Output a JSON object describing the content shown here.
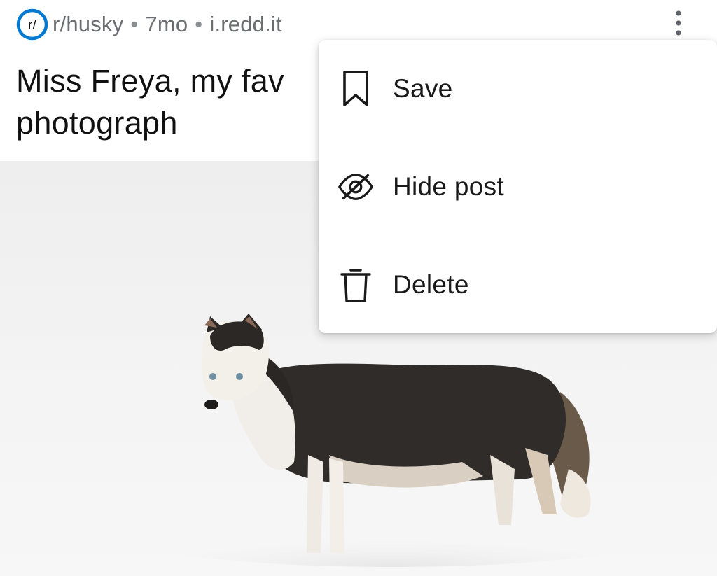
{
  "post": {
    "subreddit": "r/husky",
    "subreddit_icon_text": "r/",
    "age": "7mo",
    "domain": "i.redd.it",
    "separator": "•",
    "title_line1": "Miss Freya, my fav",
    "title_line2": "photograph"
  },
  "menu": {
    "items": [
      {
        "label": "Save",
        "icon": "bookmark-icon"
      },
      {
        "label": "Hide post",
        "icon": "eye-off-icon"
      },
      {
        "label": "Delete",
        "icon": "trash-icon"
      }
    ]
  },
  "icons": {
    "overflow": "more-vertical-icon",
    "subreddit": "subreddit-logo-icon"
  },
  "colors": {
    "subreddit_icon": "#0079d3",
    "meta_text": "#6b6d70",
    "title_text": "#111111",
    "menu_text": "#1a1a1b"
  }
}
